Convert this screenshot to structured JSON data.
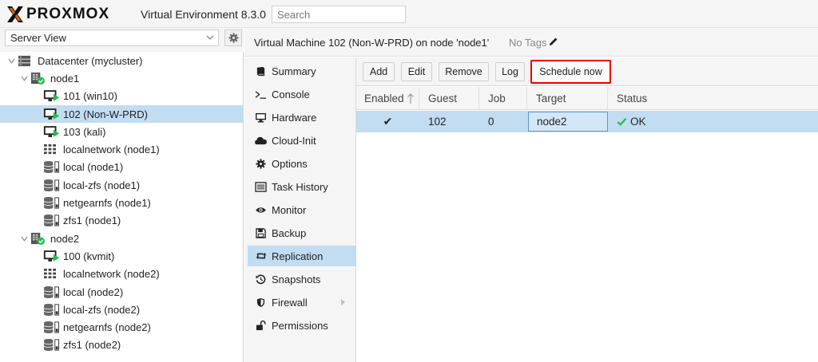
{
  "topbar": {
    "logo_text": "PROXMOX",
    "product": "Virtual Environment 8.3.0",
    "search_placeholder": "Search"
  },
  "left": {
    "view_selected": "Server View",
    "tree": [
      {
        "label": "Datacenter (mycluster)",
        "icon": "datacenter-icon"
      },
      {
        "label": "node1",
        "icon": "node-online-icon"
      },
      {
        "label": "101 (win10)",
        "icon": "vm-running-icon"
      },
      {
        "label": "102 (Non-W-PRD)",
        "icon": "vm-running-icon",
        "selected": true
      },
      {
        "label": "103 (kali)",
        "icon": "vm-running-icon"
      },
      {
        "label": "localnetwork (node1)",
        "icon": "sdn-network-icon"
      },
      {
        "label": "local (node1)",
        "icon": "storage-icon"
      },
      {
        "label": "local-zfs (node1)",
        "icon": "storage-icon"
      },
      {
        "label": "netgearnfs (node1)",
        "icon": "storage-icon"
      },
      {
        "label": "zfs1 (node1)",
        "icon": "storage-icon"
      },
      {
        "label": "node2",
        "icon": "node-online-icon"
      },
      {
        "label": "100 (kvmit)",
        "icon": "vm-running-icon"
      },
      {
        "label": "localnetwork (node2)",
        "icon": "sdn-network-icon"
      },
      {
        "label": "local (node2)",
        "icon": "storage-icon"
      },
      {
        "label": "local-zfs (node2)",
        "icon": "storage-icon"
      },
      {
        "label": "netgearnfs (node2)",
        "icon": "storage-icon"
      },
      {
        "label": "zfs1 (node2)",
        "icon": "storage-icon"
      }
    ]
  },
  "header": {
    "title": "Virtual Machine 102 (Non-W-PRD) on node 'node1'",
    "tags": "No Tags"
  },
  "nav": {
    "items": [
      {
        "label": "Summary",
        "icon": "book-icon"
      },
      {
        "label": "Console",
        "icon": "terminal-icon"
      },
      {
        "label": "Hardware",
        "icon": "desktop-icon"
      },
      {
        "label": "Cloud-Init",
        "icon": "cloud-icon"
      },
      {
        "label": "Options",
        "icon": "gear-icon"
      },
      {
        "label": "Task History",
        "icon": "list-icon"
      },
      {
        "label": "Monitor",
        "icon": "eye-icon"
      },
      {
        "label": "Backup",
        "icon": "floppy-icon"
      },
      {
        "label": "Replication",
        "icon": "retweet-icon",
        "active": true
      },
      {
        "label": "Snapshots",
        "icon": "history-icon"
      },
      {
        "label": "Firewall",
        "icon": "shield-icon"
      },
      {
        "label": "Permissions",
        "icon": "unlock-icon"
      }
    ]
  },
  "toolbar": {
    "add": "Add",
    "edit": "Edit",
    "remove": "Remove",
    "log": "Log",
    "schedule_now": "Schedule now"
  },
  "grid": {
    "columns": [
      "Enabled",
      "Guest",
      "Job",
      "Target",
      "Status"
    ],
    "rows": [
      {
        "enabled": "✔",
        "guest": "102",
        "job": "0",
        "target": "node2",
        "status": "OK"
      }
    ]
  },
  "colors": {
    "selection": "#c2dcf1",
    "ok_green": "#21bf4b",
    "logo_orange": "#e57000",
    "highlight_red": "#e00000"
  }
}
